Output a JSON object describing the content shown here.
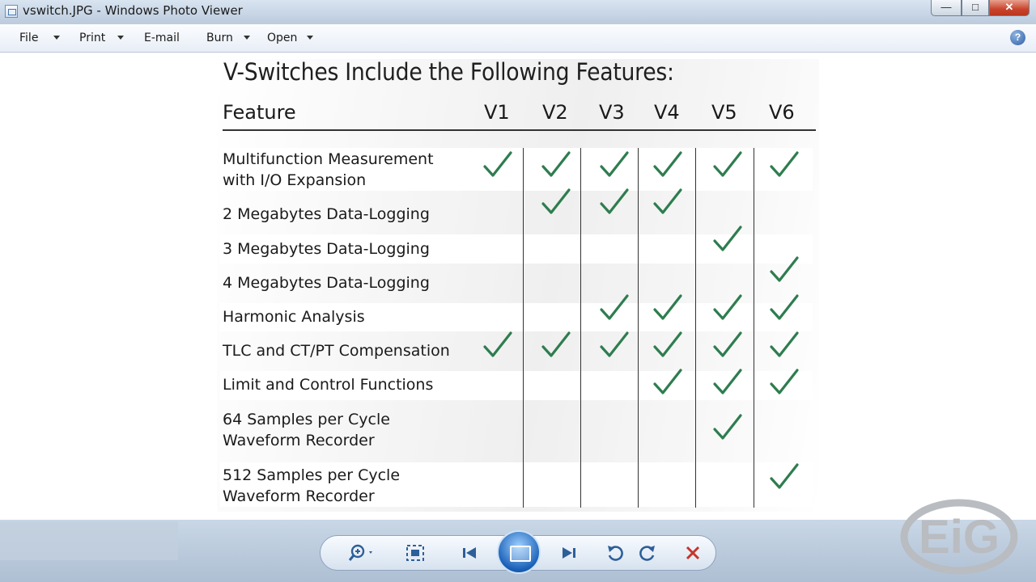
{
  "window": {
    "title": "vswitch.JPG - Windows Photo Viewer"
  },
  "caption_buttons": {
    "minimize": "—",
    "maximize": "□",
    "close": "✕"
  },
  "menu": {
    "file": "File",
    "print": "Print",
    "email": "E-mail",
    "burn": "Burn",
    "open": "Open",
    "help": "?"
  },
  "photo": {
    "title": "V-Switches Include the Following Features:",
    "header": {
      "feature": "Feature",
      "versions": [
        "V1",
        "V2",
        "V3",
        "V4",
        "V5",
        "V6"
      ]
    },
    "rows": [
      {
        "feature": [
          "Multifunction Measurement",
          "with I/O Expansion"
        ],
        "checks": [
          true,
          true,
          true,
          true,
          true,
          true
        ]
      },
      {
        "feature": [
          "2 Megabytes Data-Logging"
        ],
        "checks": [
          false,
          true,
          true,
          true,
          false,
          false
        ]
      },
      {
        "feature": [
          "3 Megabytes Data-Logging"
        ],
        "checks": [
          false,
          false,
          false,
          false,
          true,
          false
        ]
      },
      {
        "feature": [
          "4 Megabytes Data-Logging"
        ],
        "checks": [
          false,
          false,
          false,
          false,
          false,
          true
        ]
      },
      {
        "feature": [
          "Harmonic Analysis"
        ],
        "checks": [
          false,
          false,
          true,
          true,
          true,
          true
        ]
      },
      {
        "feature": [
          "TLC and CT/PT Compensation"
        ],
        "checks": [
          true,
          true,
          true,
          true,
          true,
          true
        ]
      },
      {
        "feature": [
          "Limit and Control Functions"
        ],
        "checks": [
          false,
          false,
          false,
          true,
          true,
          true
        ]
      },
      {
        "feature": [
          "64 Samples per Cycle",
          "Waveform Recorder"
        ],
        "checks": [
          false,
          false,
          false,
          false,
          true,
          false
        ]
      },
      {
        "feature": [
          "512 Samples per Cycle",
          "Waveform Recorder"
        ],
        "checks": [
          false,
          false,
          false,
          false,
          false,
          true
        ]
      }
    ],
    "check_color": "#2e7d4f"
  },
  "toolbar": {
    "icons": [
      "zoom-icon",
      "actual-size-icon",
      "previous-icon",
      "slideshow-icon",
      "next-icon",
      "rotate-left-icon",
      "rotate-right-icon",
      "delete-icon"
    ]
  },
  "logo": {
    "text": "EIG"
  }
}
